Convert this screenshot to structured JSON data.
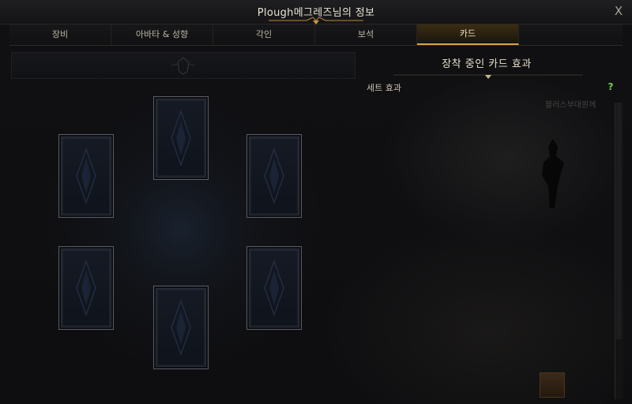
{
  "window": {
    "title": "Plough메그레즈님의 정보",
    "close_glyph": "X"
  },
  "tabs": [
    {
      "label": "장비",
      "active": false
    },
    {
      "label": "아바타 & 성향",
      "active": false
    },
    {
      "label": "각인",
      "active": false
    },
    {
      "label": "보석",
      "active": false
    },
    {
      "label": "카드",
      "active": true
    }
  ],
  "right_panel": {
    "title": "장착 중인 카드 효과",
    "set_effect_label": "세트 효과",
    "help_glyph": "?",
    "help_color": "#6fd442"
  },
  "background_text": "블러스부대원께",
  "card_slots_count": 6,
  "colors": {
    "accent_gold": "#d9a441",
    "active_tab_bg": "#3a2c12"
  },
  "icons": {
    "close": "close-icon",
    "help": "help-icon",
    "card_back": "card-back-icon",
    "emblem": "emblem-icon"
  }
}
